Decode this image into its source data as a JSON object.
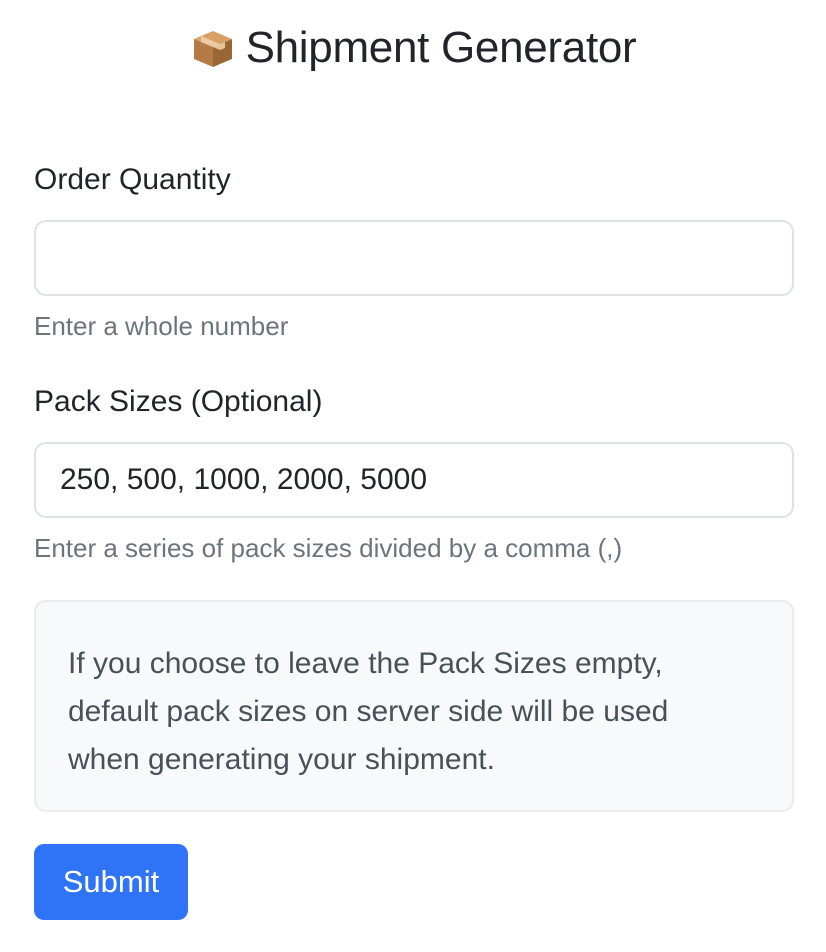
{
  "header": {
    "title": "Shipment Generator",
    "icon": "package-box-icon"
  },
  "form": {
    "order_quantity": {
      "label": "Order Quantity",
      "value": "",
      "placeholder": "",
      "help": "Enter a whole number"
    },
    "pack_sizes": {
      "label": "Pack Sizes (Optional)",
      "value": "250, 500, 1000, 2000, 5000",
      "help": "Enter a series of pack sizes divided by a comma (,)"
    },
    "info": "If you choose to leave the Pack Sizes empty, default pack sizes on server side will be used when generating your shipment.",
    "submit_label": "Submit"
  },
  "colors": {
    "primary": "#2f74f6",
    "text": "#212529",
    "muted": "#6c757d",
    "info_bg": "#f8f9fa",
    "border": "#dee2e6"
  }
}
